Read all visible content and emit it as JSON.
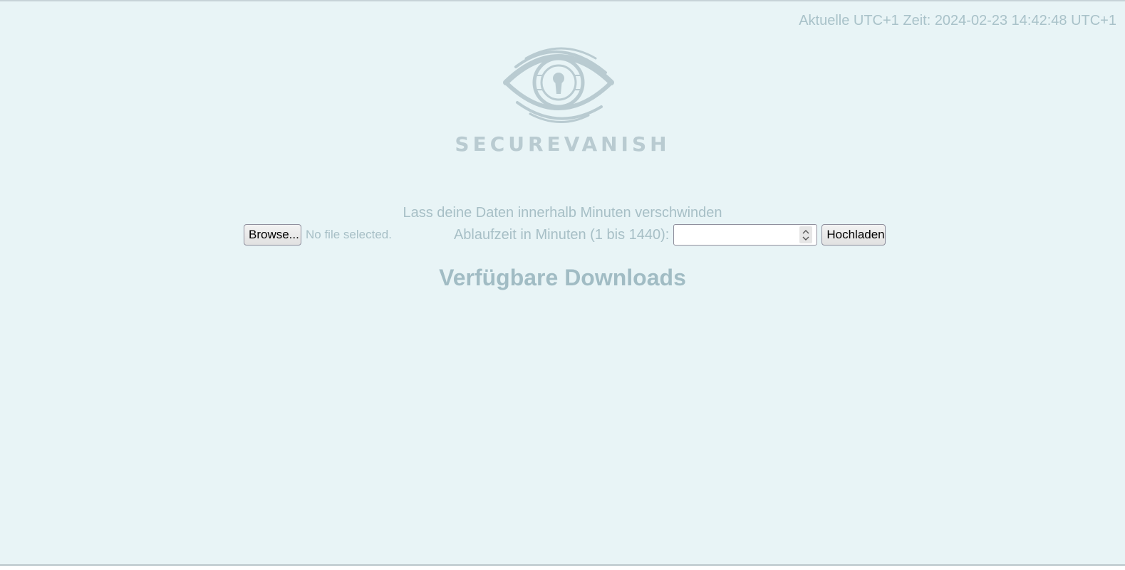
{
  "header": {
    "clock_text": "Aktuelle UTC+1 Zeit: 2024-02-23 14:42:48 UTC+1"
  },
  "logo": {
    "text": "SECUREVANISH",
    "icon": "eye-lock-icon",
    "color": "#b9cbd1"
  },
  "upload": {
    "tagline": "Lass deine Daten innerhalb Minuten verschwinden",
    "browse_label": "Browse...",
    "file_status": "No file selected.",
    "expiry_label": "Ablaufzeit in Minuten (1 bis 1440):",
    "expiry_value": "",
    "submit_label": "Hochladen"
  },
  "downloads": {
    "heading": "Verfügbare Downloads"
  },
  "colors": {
    "background": "#e8f4f6",
    "text": "#a7bfc6"
  }
}
